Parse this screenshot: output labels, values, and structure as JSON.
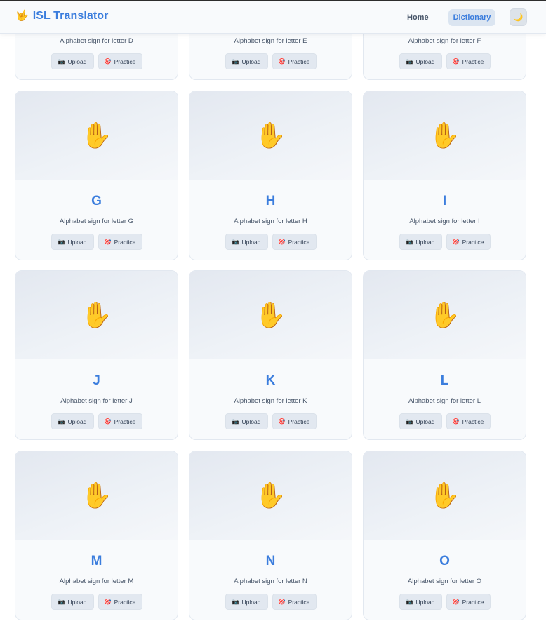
{
  "nav": {
    "brand_icon": "🤟",
    "brand_name": "ISL Translator",
    "home": "Home",
    "dictionary": "Dictionary",
    "theme_icon": "🌙"
  },
  "card_common": {
    "hand_emoji": "✋",
    "upload_icon": "📷",
    "upload": "Upload",
    "practice_icon": "🎯",
    "practice": "Practice"
  },
  "cards": [
    {
      "letter": "D",
      "desc": "Alphabet sign for letter D"
    },
    {
      "letter": "E",
      "desc": "Alphabet sign for letter E"
    },
    {
      "letter": "F",
      "desc": "Alphabet sign for letter F"
    },
    {
      "letter": "G",
      "desc": "Alphabet sign for letter G"
    },
    {
      "letter": "H",
      "desc": "Alphabet sign for letter H"
    },
    {
      "letter": "I",
      "desc": "Alphabet sign for letter I"
    },
    {
      "letter": "J",
      "desc": "Alphabet sign for letter J"
    },
    {
      "letter": "K",
      "desc": "Alphabet sign for letter K"
    },
    {
      "letter": "L",
      "desc": "Alphabet sign for letter L"
    },
    {
      "letter": "M",
      "desc": "Alphabet sign for letter M"
    },
    {
      "letter": "N",
      "desc": "Alphabet sign for letter N"
    },
    {
      "letter": "O",
      "desc": "Alphabet sign for letter O"
    }
  ]
}
